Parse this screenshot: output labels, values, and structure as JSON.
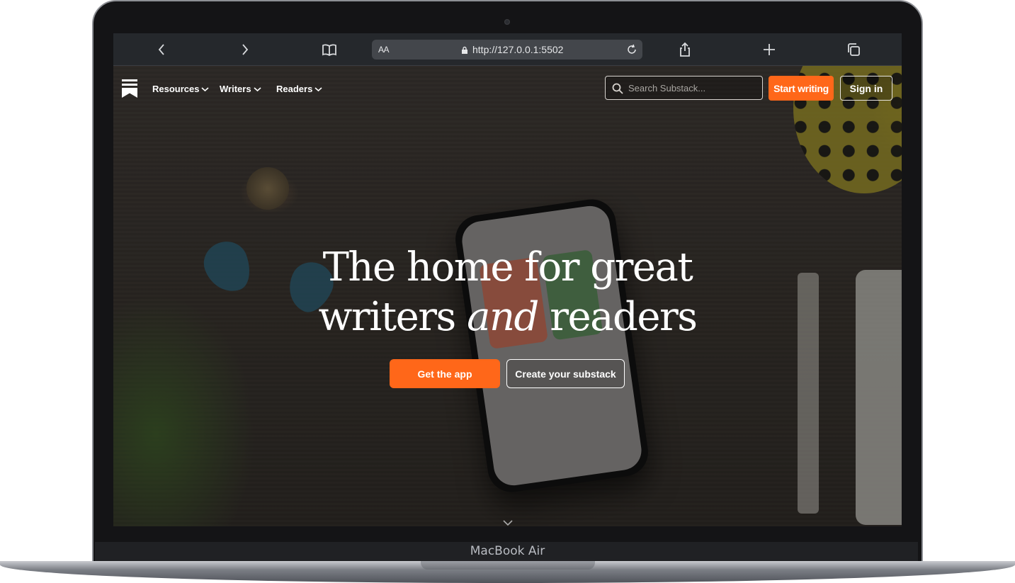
{
  "device": {
    "model_label": "MacBook Air"
  },
  "browser": {
    "text_size_label": "AA",
    "url": "http://127.0.0.1:5502"
  },
  "site": {
    "nav": {
      "items": [
        {
          "label": "Resources"
        },
        {
          "label": "Writers"
        },
        {
          "label": "Readers"
        }
      ],
      "search_placeholder": "Search Substack...",
      "start_writing_label": "Start writing",
      "sign_in_label": "Sign in"
    },
    "hero": {
      "line1": "The home for great",
      "line2_a": "writers",
      "line2_em": "and",
      "line2_b": "readers"
    },
    "cta": {
      "get_app_label": "Get the app",
      "create_label": "Create your substack"
    },
    "colors": {
      "accent": "#ff6719"
    }
  }
}
